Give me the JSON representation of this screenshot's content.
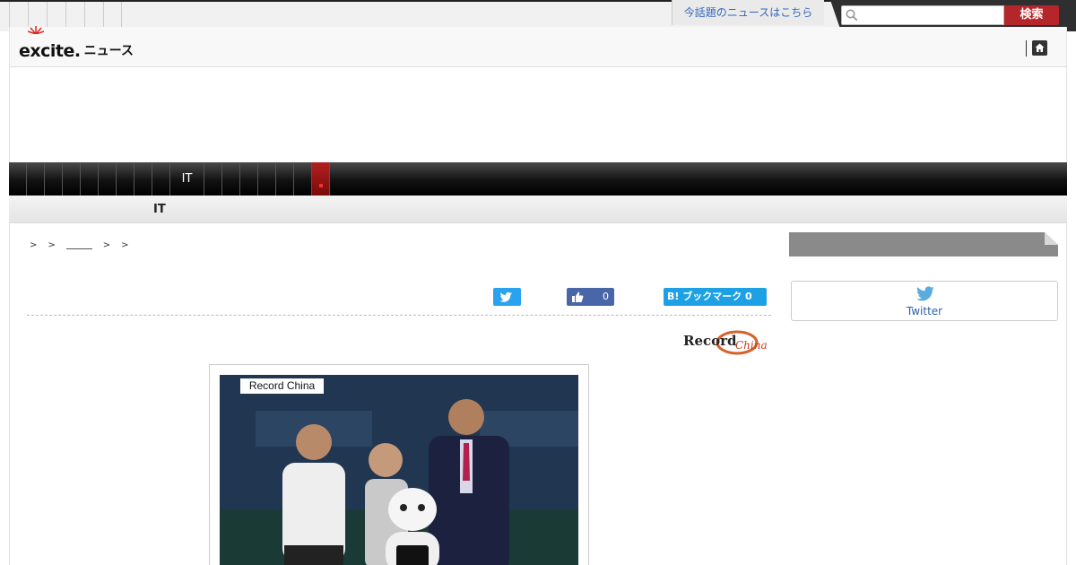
{
  "topbar": {
    "topics_link": "今話題のニュースはこちら",
    "search": {
      "placeholder": "",
      "button_label": "検索"
    }
  },
  "header": {
    "logo_text": "excite.",
    "service_name": "ニュース"
  },
  "nav": {
    "items": [
      "",
      "",
      "",
      "",
      "",
      "",
      "",
      "",
      "",
      "IT",
      "",
      "",
      "",
      "",
      "",
      "",
      ""
    ],
    "active_index": 16
  },
  "subnav": {
    "label": "IT"
  },
  "breadcrumb": {
    "separator": ">"
  },
  "share": {
    "facebook_count": "0",
    "hatena_label": "B! ブックマーク 0"
  },
  "article": {
    "source_logo_text": "Record",
    "source_logo_sub": "China",
    "photo_credit": "Record China"
  },
  "sidebar": {
    "twitter_label": "Twitter"
  },
  "colors": {
    "search_button": "#b5262b",
    "nav_active": "#8c1414",
    "twitter": "#2aa3ef",
    "facebook": "#4967a8",
    "hatena": "#1ea1e4"
  }
}
